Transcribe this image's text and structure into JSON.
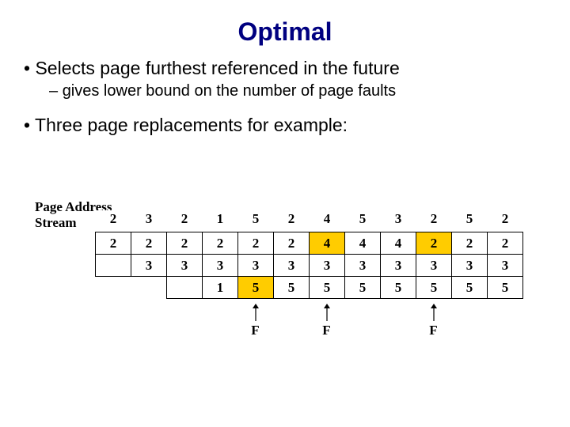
{
  "title": "Optimal",
  "bullets": {
    "b1": "Selects page furthest referenced in the future",
    "b1_sub": "gives lower bound on the number of page faults",
    "b2": "Three page replacements for example:"
  },
  "stream_label_l1": "Page Address",
  "stream_label_l2": "Stream",
  "stream": [
    "2",
    "3",
    "2",
    "1",
    "5",
    "2",
    "4",
    "5",
    "3",
    "2",
    "5",
    "2"
  ],
  "frames": {
    "r0": [
      "2",
      "2",
      "2",
      "2",
      "2",
      "2",
      "4",
      "4",
      "4",
      "2",
      "2",
      "2"
    ],
    "r1": [
      "",
      "3",
      "3",
      "3",
      "3",
      "3",
      "3",
      "3",
      "3",
      "3",
      "3",
      "3"
    ],
    "r2": [
      "",
      "",
      "",
      "1",
      "5",
      "5",
      "5",
      "5",
      "5",
      "5",
      "5",
      "5"
    ]
  },
  "frames_hl": {
    "r0": [
      false,
      false,
      false,
      false,
      false,
      false,
      true,
      false,
      false,
      true,
      false,
      false
    ],
    "r1": [
      false,
      false,
      false,
      false,
      false,
      false,
      false,
      false,
      false,
      false,
      false,
      false
    ],
    "r2": [
      false,
      false,
      false,
      false,
      true,
      false,
      false,
      false,
      false,
      false,
      false,
      false
    ]
  },
  "frames_none": {
    "r0": [
      false,
      false,
      false,
      false,
      false,
      false,
      false,
      false,
      false,
      false,
      false,
      false
    ],
    "r1": [
      false,
      false,
      false,
      false,
      false,
      false,
      false,
      false,
      false,
      false,
      false,
      false
    ],
    "r2": [
      true,
      true,
      false,
      false,
      false,
      false,
      false,
      false,
      false,
      false,
      false,
      false
    ]
  },
  "faults": {
    "4": "F",
    "6": "F",
    "9": "F"
  },
  "fault_label": "F"
}
